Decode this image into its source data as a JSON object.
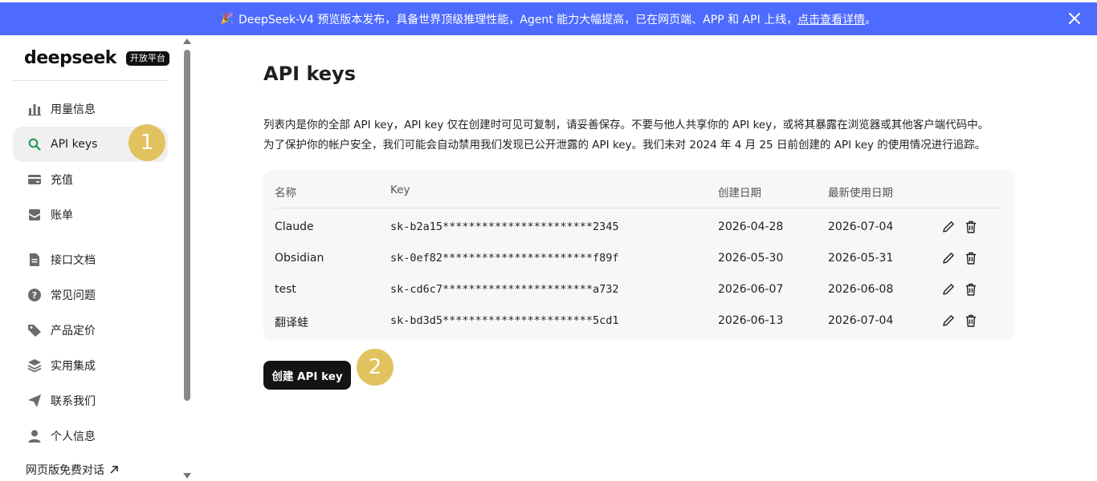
{
  "banner": {
    "flag": "🎉",
    "text": "DeepSeek-V4 预览版本发布，具备世界顶级推理性能，Agent 能力大幅提高，已在网页端、APP 和 API 上线，",
    "link": "点击查看详情",
    "suffix": "。",
    "close_icon": "close-icon",
    "bg_color": "#4d6bfe"
  },
  "sidebar": {
    "logo": "deepseek",
    "badge": "开放平台",
    "items": [
      {
        "label": "用量信息",
        "icon": "bar-chart-icon"
      },
      {
        "label": "API keys",
        "icon": "search-icon",
        "active": true
      },
      {
        "label": "充值",
        "icon": "wallet-icon"
      },
      {
        "label": "账单",
        "icon": "bill-icon"
      },
      {
        "label": "接口文档",
        "icon": "document-icon"
      },
      {
        "label": "常见问题",
        "icon": "question-icon"
      },
      {
        "label": "产品定价",
        "icon": "price-tag-icon"
      },
      {
        "label": "实用集成",
        "icon": "layers-icon"
      },
      {
        "label": "联系我们",
        "icon": "send-icon"
      },
      {
        "label": "个人信息",
        "icon": "user-icon"
      }
    ],
    "web_chat": "网页版免费对话"
  },
  "main": {
    "title": "API keys",
    "desc_line1": "列表内是你的全部 API key，API key 仅在创建时可见可复制，请妥善保存。不要与他人共享你的 API key，或将其暴露在浏览器或其他客户端代码中。",
    "desc_line2": "为了保护你的帐户安全，我们可能会自动禁用我们发现已公开泄露的 API key。我们未对 2024 年 4 月 25 日前创建的 API key 的使用情况进行追踪。",
    "table": {
      "headers": [
        "名称",
        "Key",
        "创建日期",
        "最新使用日期"
      ],
      "rows": [
        {
          "name": "Claude",
          "key": "sk-b2a15***********************2345",
          "created": "2026-04-28",
          "last_used": "2026-07-04"
        },
        {
          "name": "Obsidian",
          "key": "sk-0ef82***********************f89f",
          "created": "2026-05-30",
          "last_used": "2026-05-31"
        },
        {
          "name": "test",
          "key": "sk-cd6c7***********************a732",
          "created": "2026-06-07",
          "last_used": "2026-06-08"
        },
        {
          "name": "翻译蛙",
          "key": "sk-bd3d5***********************5cd1",
          "created": "2026-06-13",
          "last_used": "2026-07-04"
        }
      ]
    },
    "create_button": "创建 API key"
  },
  "annotations": {
    "marker1": "1",
    "marker2": "2",
    "color": "#e2c25e"
  }
}
